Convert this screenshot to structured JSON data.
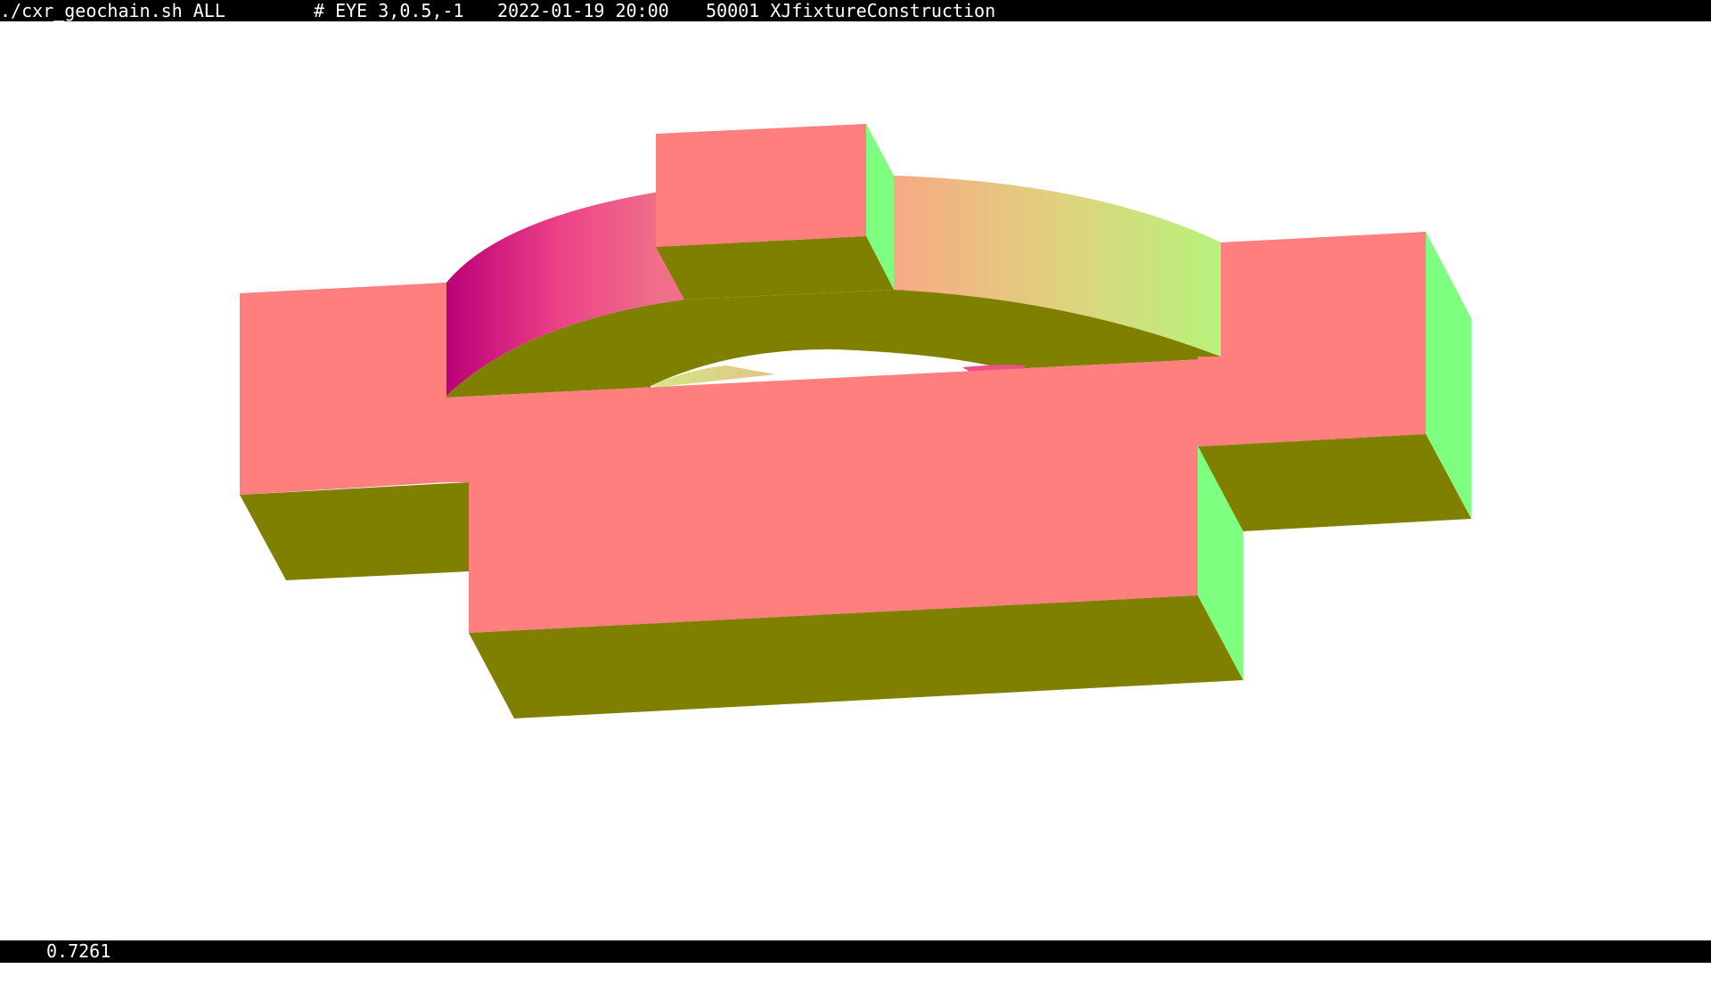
{
  "title_bar": {
    "command": "./cxr_geochain.sh ALL",
    "eye": "# EYE 3,0.5,-1",
    "datetime": "2022-01-19 20:00",
    "geometry": "50001 XJfixtureConstruction"
  },
  "status_bar": {
    "value": "0.7261"
  },
  "colors": {
    "bar_background": "#000000",
    "bar_text": "#ffffff",
    "background": "#ffffff",
    "front_face": "#ff7f7f",
    "top_face": "#808000",
    "side_face": "#7fff7f",
    "ring_magenta": "#bb0077",
    "ring_pink": "#ee4488",
    "ring_peach": "#f7a984",
    "ring_lime": "#b8f27c"
  },
  "icons": {
    "render": "3d-geometry-render"
  }
}
